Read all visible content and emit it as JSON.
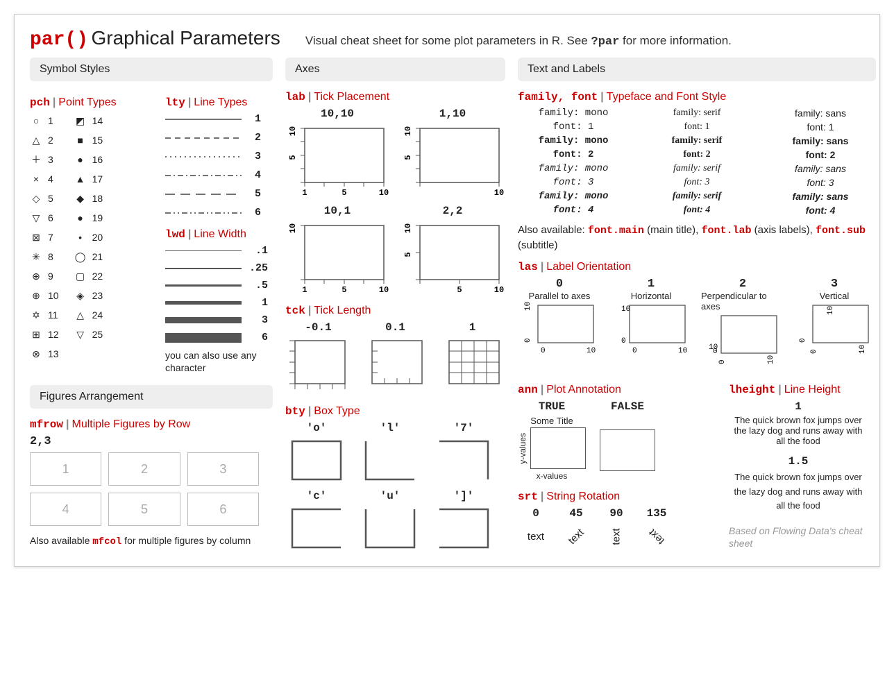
{
  "title": {
    "code": "par()",
    "text": "Graphical Parameters"
  },
  "subtitle": {
    "pre": "Visual cheat sheet for some plot parameters in R. See ",
    "code": "?par",
    "post": " for more information."
  },
  "sections": {
    "symbols": "Symbol Styles",
    "axes": "Axes",
    "text": "Text and Labels",
    "figarr": "Figures Arrangement"
  },
  "pch": {
    "code": "pch",
    "desc": "Point Types",
    "col1": [
      {
        "s": "○",
        "n": "1"
      },
      {
        "s": "△",
        "n": "2"
      },
      {
        "s": "＋",
        "n": "3"
      },
      {
        "s": "×",
        "n": "4"
      },
      {
        "s": "◇",
        "n": "5"
      },
      {
        "s": "▽",
        "n": "6"
      },
      {
        "s": "⊠",
        "n": "7"
      },
      {
        "s": "✳",
        "n": "8"
      },
      {
        "s": "⊕",
        "n": "9"
      },
      {
        "s": "⊕",
        "n": "10"
      },
      {
        "s": "✡",
        "n": "11"
      },
      {
        "s": "⊞",
        "n": "12"
      },
      {
        "s": "⊗",
        "n": "13"
      }
    ],
    "col2": [
      {
        "s": "◩",
        "n": "14"
      },
      {
        "s": "■",
        "n": "15"
      },
      {
        "s": "●",
        "n": "16"
      },
      {
        "s": "▲",
        "n": "17"
      },
      {
        "s": "◆",
        "n": "18"
      },
      {
        "s": "●",
        "n": "19"
      },
      {
        "s": "•",
        "n": "20"
      },
      {
        "s": "◯",
        "n": "21"
      },
      {
        "s": "▢",
        "n": "22"
      },
      {
        "s": "◈",
        "n": "23"
      },
      {
        "s": "△",
        "n": "24"
      },
      {
        "s": "▽",
        "n": "25"
      }
    ],
    "note": "you can also use any character"
  },
  "lty": {
    "code": "lty",
    "desc": "Line Types",
    "items": [
      {
        "n": "1",
        "dash": "none"
      },
      {
        "n": "2",
        "dash": "8,6"
      },
      {
        "n": "3",
        "dash": "2,5"
      },
      {
        "n": "4",
        "dash": "8,4,2,4"
      },
      {
        "n": "5",
        "dash": "14,8"
      },
      {
        "n": "6",
        "dash": "8,4,2,4,2,4"
      }
    ]
  },
  "lwd": {
    "code": "lwd",
    "desc": "Line Width",
    "items": [
      {
        "n": ".1",
        "h": 1
      },
      {
        "n": ".25",
        "h": 2
      },
      {
        "n": ".5",
        "h": 3
      },
      {
        "n": "1",
        "h": 5
      },
      {
        "n": "3",
        "h": 9
      },
      {
        "n": "6",
        "h": 14
      }
    ]
  },
  "mfrow": {
    "code": "mfrow",
    "desc": "Multiple Figures by Row",
    "val": "2,3",
    "cells": [
      "1",
      "2",
      "3",
      "4",
      "5",
      "6"
    ],
    "also_pre": "Also available ",
    "also_code": "mfcol",
    "also_post": " for multiple figures by column"
  },
  "lab": {
    "code": "lab",
    "desc": "Tick Placement",
    "plots": [
      {
        "t": "10,10"
      },
      {
        "t": "1,10"
      },
      {
        "t": "10,1"
      },
      {
        "t": "2,2"
      }
    ]
  },
  "tck": {
    "code": "tck",
    "desc": "Tick Length",
    "plots": [
      {
        "t": "-0.1"
      },
      {
        "t": "0.1"
      },
      {
        "t": "1"
      }
    ]
  },
  "bty": {
    "code": "bty",
    "desc": "Box Type",
    "plots": [
      {
        "t": "'o'"
      },
      {
        "t": "'l'"
      },
      {
        "t": "'7'"
      },
      {
        "t": "'c'"
      },
      {
        "t": "'u'"
      },
      {
        "t": "']'"
      }
    ]
  },
  "family": {
    "code": "family, font",
    "desc": "Typeface and Font Style",
    "rows": [
      {
        "mono": "family: mono",
        "serif": "family: serif",
        "sans": "family: sans"
      },
      {
        "mono": "font: 1",
        "serif": "font: 1",
        "sans": "font: 1"
      },
      {
        "mono": "family: mono",
        "serif": "family: serif",
        "sans": "family: sans"
      },
      {
        "mono": "font: 2",
        "serif": "font: 2",
        "sans": "font: 2"
      },
      {
        "mono": "family: mono",
        "serif": "family: serif",
        "sans": "family: sans"
      },
      {
        "mono": "font: 3",
        "serif": "font: 3",
        "sans": "font: 3"
      },
      {
        "mono": "family: mono",
        "serif": "family: serif",
        "sans": "family: sans"
      },
      {
        "mono": "font: 4",
        "serif": "font: 4",
        "sans": "font: 4"
      }
    ],
    "also": {
      "pre": "Also available: ",
      "c1": "font.main",
      "t1": " (main title), ",
      "c2": "font.lab",
      "t2": " (axis labels), ",
      "c3": "font.sub",
      "t3": " (subtitle)"
    }
  },
  "las": {
    "code": "las",
    "desc": "Label Orientation",
    "items": [
      {
        "n": "0",
        "d": "Parallel to axes"
      },
      {
        "n": "1",
        "d": "Horizontal"
      },
      {
        "n": "2",
        "d": "Perpendicular to axes"
      },
      {
        "n": "3",
        "d": "Vertical"
      }
    ]
  },
  "ann": {
    "code": "ann",
    "desc": "Plot Annotation",
    "true": "TRUE",
    "false": "FALSE",
    "title": "Some Title",
    "xlab": "x-values",
    "ylab": "y-values"
  },
  "lheight": {
    "code": "lheight",
    "desc": "Line Height",
    "n1": "1",
    "n2": "1.5",
    "text": "The quick brown fox jumps over the lazy dog and runs away with all the food"
  },
  "srt": {
    "code": "srt",
    "desc": "String Rotation",
    "items": [
      {
        "n": "0",
        "a": 0
      },
      {
        "n": "45",
        "a": 45
      },
      {
        "n": "90",
        "a": 90
      },
      {
        "n": "135",
        "a": 135
      }
    ],
    "word": "text"
  },
  "credit": "Based on Flowing Data's cheat sheet"
}
